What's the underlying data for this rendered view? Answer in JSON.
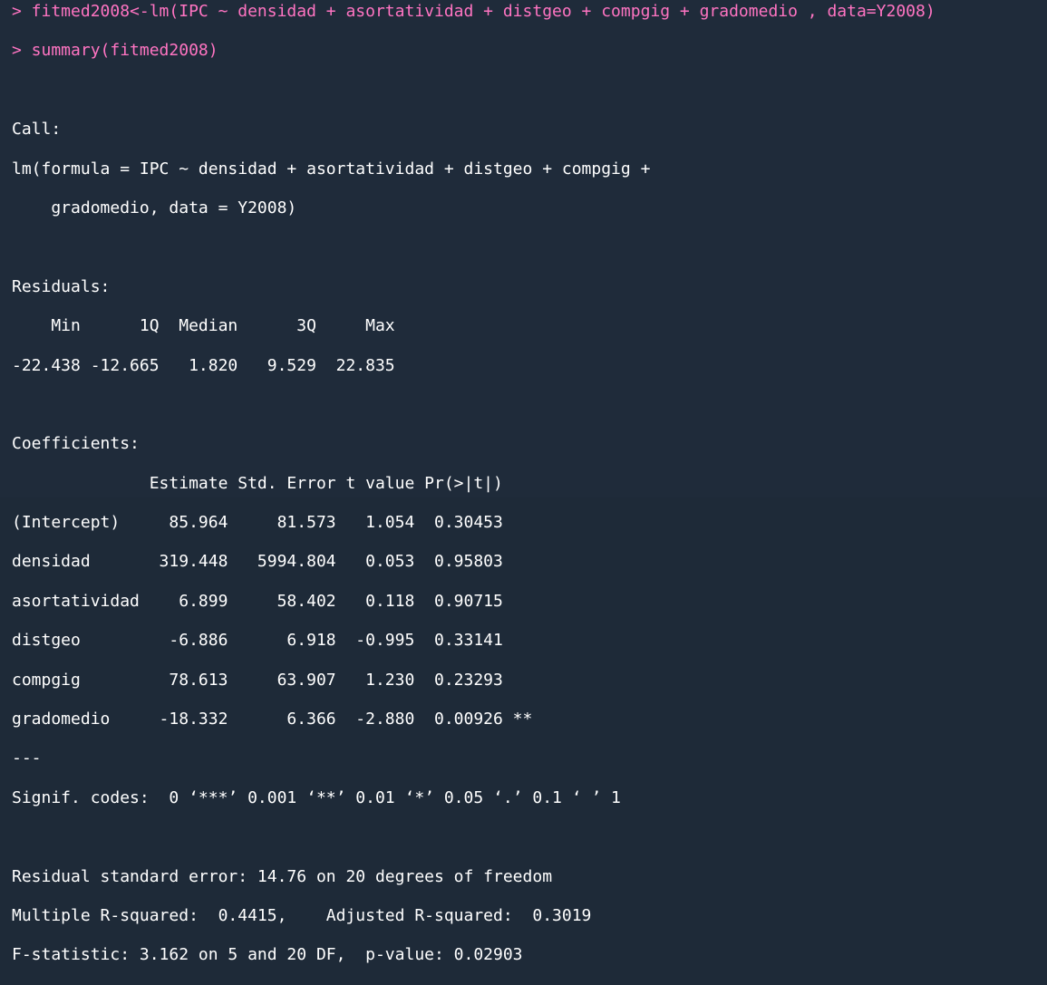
{
  "console": {
    "lines": [
      {
        "type": "command",
        "text": "> fitmed2008<-lm(IPC ~ densidad + asortatividad + distgeo + compgig + gradomedio , data=Y2008)"
      },
      {
        "type": "command",
        "text": "> summary(fitmed2008)"
      },
      {
        "type": "output",
        "text": ""
      },
      {
        "type": "output",
        "text": "Call:"
      },
      {
        "type": "output",
        "text": "lm(formula = IPC ~ densidad + asortatividad + distgeo + compgig +"
      },
      {
        "type": "output",
        "text": "    gradomedio, data = Y2008)"
      },
      {
        "type": "output",
        "text": ""
      },
      {
        "type": "output",
        "text": "Residuals:"
      },
      {
        "type": "output",
        "text": "    Min      1Q  Median      3Q     Max "
      },
      {
        "type": "output",
        "text": "-22.438 -12.665   1.820   9.529  22.835 "
      },
      {
        "type": "output",
        "text": ""
      },
      {
        "type": "output",
        "text": "Coefficients:"
      },
      {
        "type": "output",
        "text": "              Estimate Std. Error t value Pr(>|t|)   "
      },
      {
        "type": "output",
        "text": "(Intercept)     85.964     81.573   1.054  0.30453   "
      },
      {
        "type": "output",
        "text": "densidad       319.448   5994.804   0.053  0.95803   "
      },
      {
        "type": "output",
        "text": "asortatividad    6.899     58.402   0.118  0.90715   "
      },
      {
        "type": "output",
        "text": "distgeo         -6.886      6.918  -0.995  0.33141   "
      },
      {
        "type": "output",
        "text": "compgig         78.613     63.907   1.230  0.23293   "
      },
      {
        "type": "output",
        "text": "gradomedio     -18.332      6.366  -2.880  0.00926 **"
      },
      {
        "type": "output",
        "text": "---"
      },
      {
        "type": "output",
        "text": "Signif. codes:  0 ‘***’ 0.001 ‘**’ 0.01 ‘*’ 0.05 ‘.’ 0.1 ‘ ’ 1"
      },
      {
        "type": "output",
        "text": ""
      },
      {
        "type": "output",
        "text": "Residual standard error: 14.76 on 20 degrees of freedom"
      },
      {
        "type": "output",
        "text": "Multiple R-squared:  0.4415,    Adjusted R-squared:  0.3019 "
      },
      {
        "type": "output",
        "text": "F-statistic: 3.162 on 5 and 20 DF,  p-value: 0.02903"
      }
    ]
  },
  "colors": {
    "background": "#1f2b3a",
    "command_text": "#ff74c2",
    "output_text": "#ffffff"
  }
}
